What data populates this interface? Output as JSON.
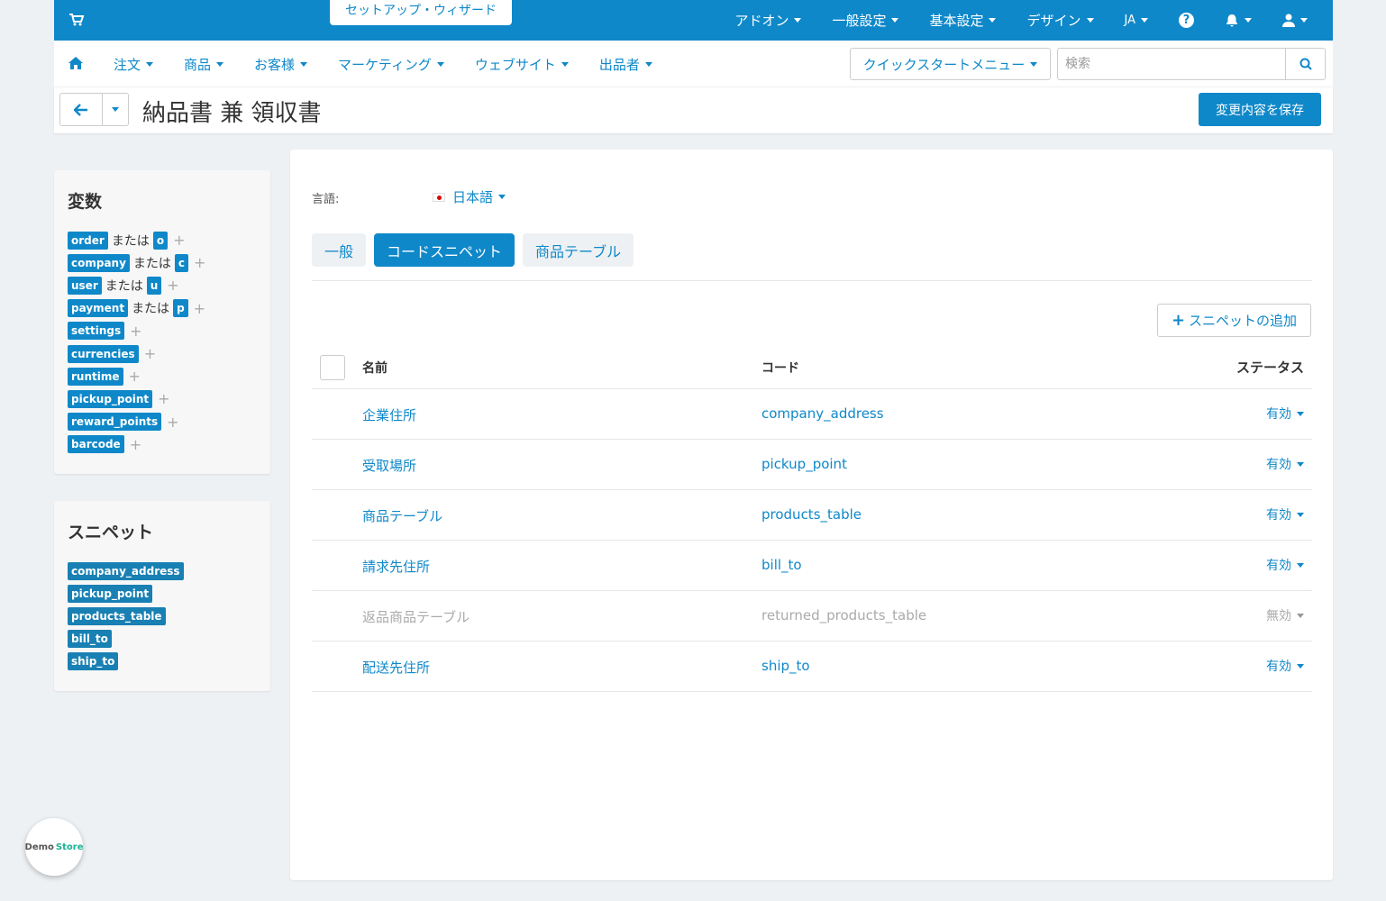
{
  "topbar": {
    "wizard_label": "セットアップ・ウィザード",
    "menu": [
      "アドオン",
      "一般設定",
      "基本設定",
      "デザイン",
      "JA"
    ]
  },
  "nav": {
    "items": [
      "注文",
      "商品",
      "お客様",
      "マーケティング",
      "ウェブサイト",
      "出品者"
    ],
    "quickstart": "クイックスタートメニュー",
    "search_placeholder": "検索"
  },
  "titlebar": {
    "title": "納品書 兼 領収書",
    "save_label": "変更内容を保存"
  },
  "variables": {
    "heading": "変数",
    "or_text": "または",
    "items": [
      {
        "name": "order",
        "short": "o"
      },
      {
        "name": "company",
        "short": "c"
      },
      {
        "name": "user",
        "short": "u"
      },
      {
        "name": "payment",
        "short": "p"
      },
      {
        "name": "settings"
      },
      {
        "name": "currencies"
      },
      {
        "name": "runtime"
      },
      {
        "name": "pickup_point"
      },
      {
        "name": "reward_points"
      },
      {
        "name": "barcode"
      }
    ]
  },
  "snippets_side": {
    "heading": "スニペット",
    "items": [
      "company_address",
      "pickup_point",
      "products_table",
      "bill_to",
      "ship_to"
    ]
  },
  "main": {
    "language_label": "言語:",
    "language_value": "日本語",
    "tabs": [
      "一般",
      "コードスニペット",
      "商品テーブル"
    ],
    "active_tab": "コードスニペット",
    "add_snippet_label": "スニペットの追加",
    "columns": {
      "name": "名前",
      "code": "コード",
      "status": "ステータス"
    },
    "rows": [
      {
        "name": "企業住所",
        "code": "company_address",
        "status": "有効"
      },
      {
        "name": "受取場所",
        "code": "pickup_point",
        "status": "有効"
      },
      {
        "name": "商品テーブル",
        "code": "products_table",
        "status": "有効"
      },
      {
        "name": "請求先住所",
        "code": "bill_to",
        "status": "有効"
      },
      {
        "name": "返品商品テーブル",
        "code": "returned_products_table",
        "status": "無効"
      },
      {
        "name": "配送先住所",
        "code": "ship_to",
        "status": "有効"
      }
    ]
  },
  "badge": {
    "part1": "Demo",
    "part2": "Store"
  },
  "colors": {
    "primary": "#0f88c9",
    "background": "#eef1f4",
    "disabled_text": "#aaaaaa",
    "badge_green": "#1ab394"
  }
}
